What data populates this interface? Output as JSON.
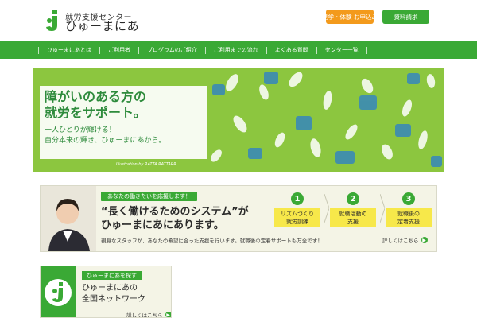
{
  "header": {
    "logo_sub": "就労支援センター",
    "logo_main": "ひゅーまにあ",
    "logo_icon": "j-bird-logo-icon",
    "btn_visit": "見学・体験 お申込み",
    "btn_docs": "資料請求"
  },
  "nav": {
    "items": [
      {
        "label": "ひゅーまにあとは"
      },
      {
        "label": "ご利用者"
      },
      {
        "label": "プログラムのご紹介"
      },
      {
        "label": "ご利用までの流れ"
      },
      {
        "label": "よくある質問"
      },
      {
        "label": "センター一覧"
      }
    ]
  },
  "hero": {
    "title_line1": "障がいのある方の",
    "title_line2": "就労をサポート。",
    "sub_line1": "一人ひとりが輝ける！",
    "sub_line2": "自分本来の輝き、ひゅーまにあから。",
    "credit": "Illustration by RATTA RATTARR"
  },
  "banner": {
    "tag": "あなたの働きたいを応援します！",
    "head_line1": "“長く働けるためのシステム”が",
    "head_line2": "ひゅーまにあにあります。",
    "desc": "親身なスタッフが、あなたの希望に合った支援を行います。就職後の定着サポートも万全です！",
    "more": "詳しくはこちら",
    "steps": [
      {
        "num": "1",
        "line1": "リズムづくり",
        "line2": "就労訓練"
      },
      {
        "num": "2",
        "line1": "就職活動の",
        "line2": "支援"
      },
      {
        "num": "3",
        "line1": "就職後の",
        "line2": "定着支援"
      }
    ]
  },
  "network": {
    "tag": "ひゅーまにあを探す",
    "title_line1": "ひゅーまにあの",
    "title_line2": "全国ネットワーク",
    "more": "詳しくはこちら"
  },
  "colors": {
    "brand_green": "#3aa935",
    "accent_orange": "#f39a1c",
    "hero_green": "#8cc63f",
    "step_yellow": "#f7e84a"
  }
}
